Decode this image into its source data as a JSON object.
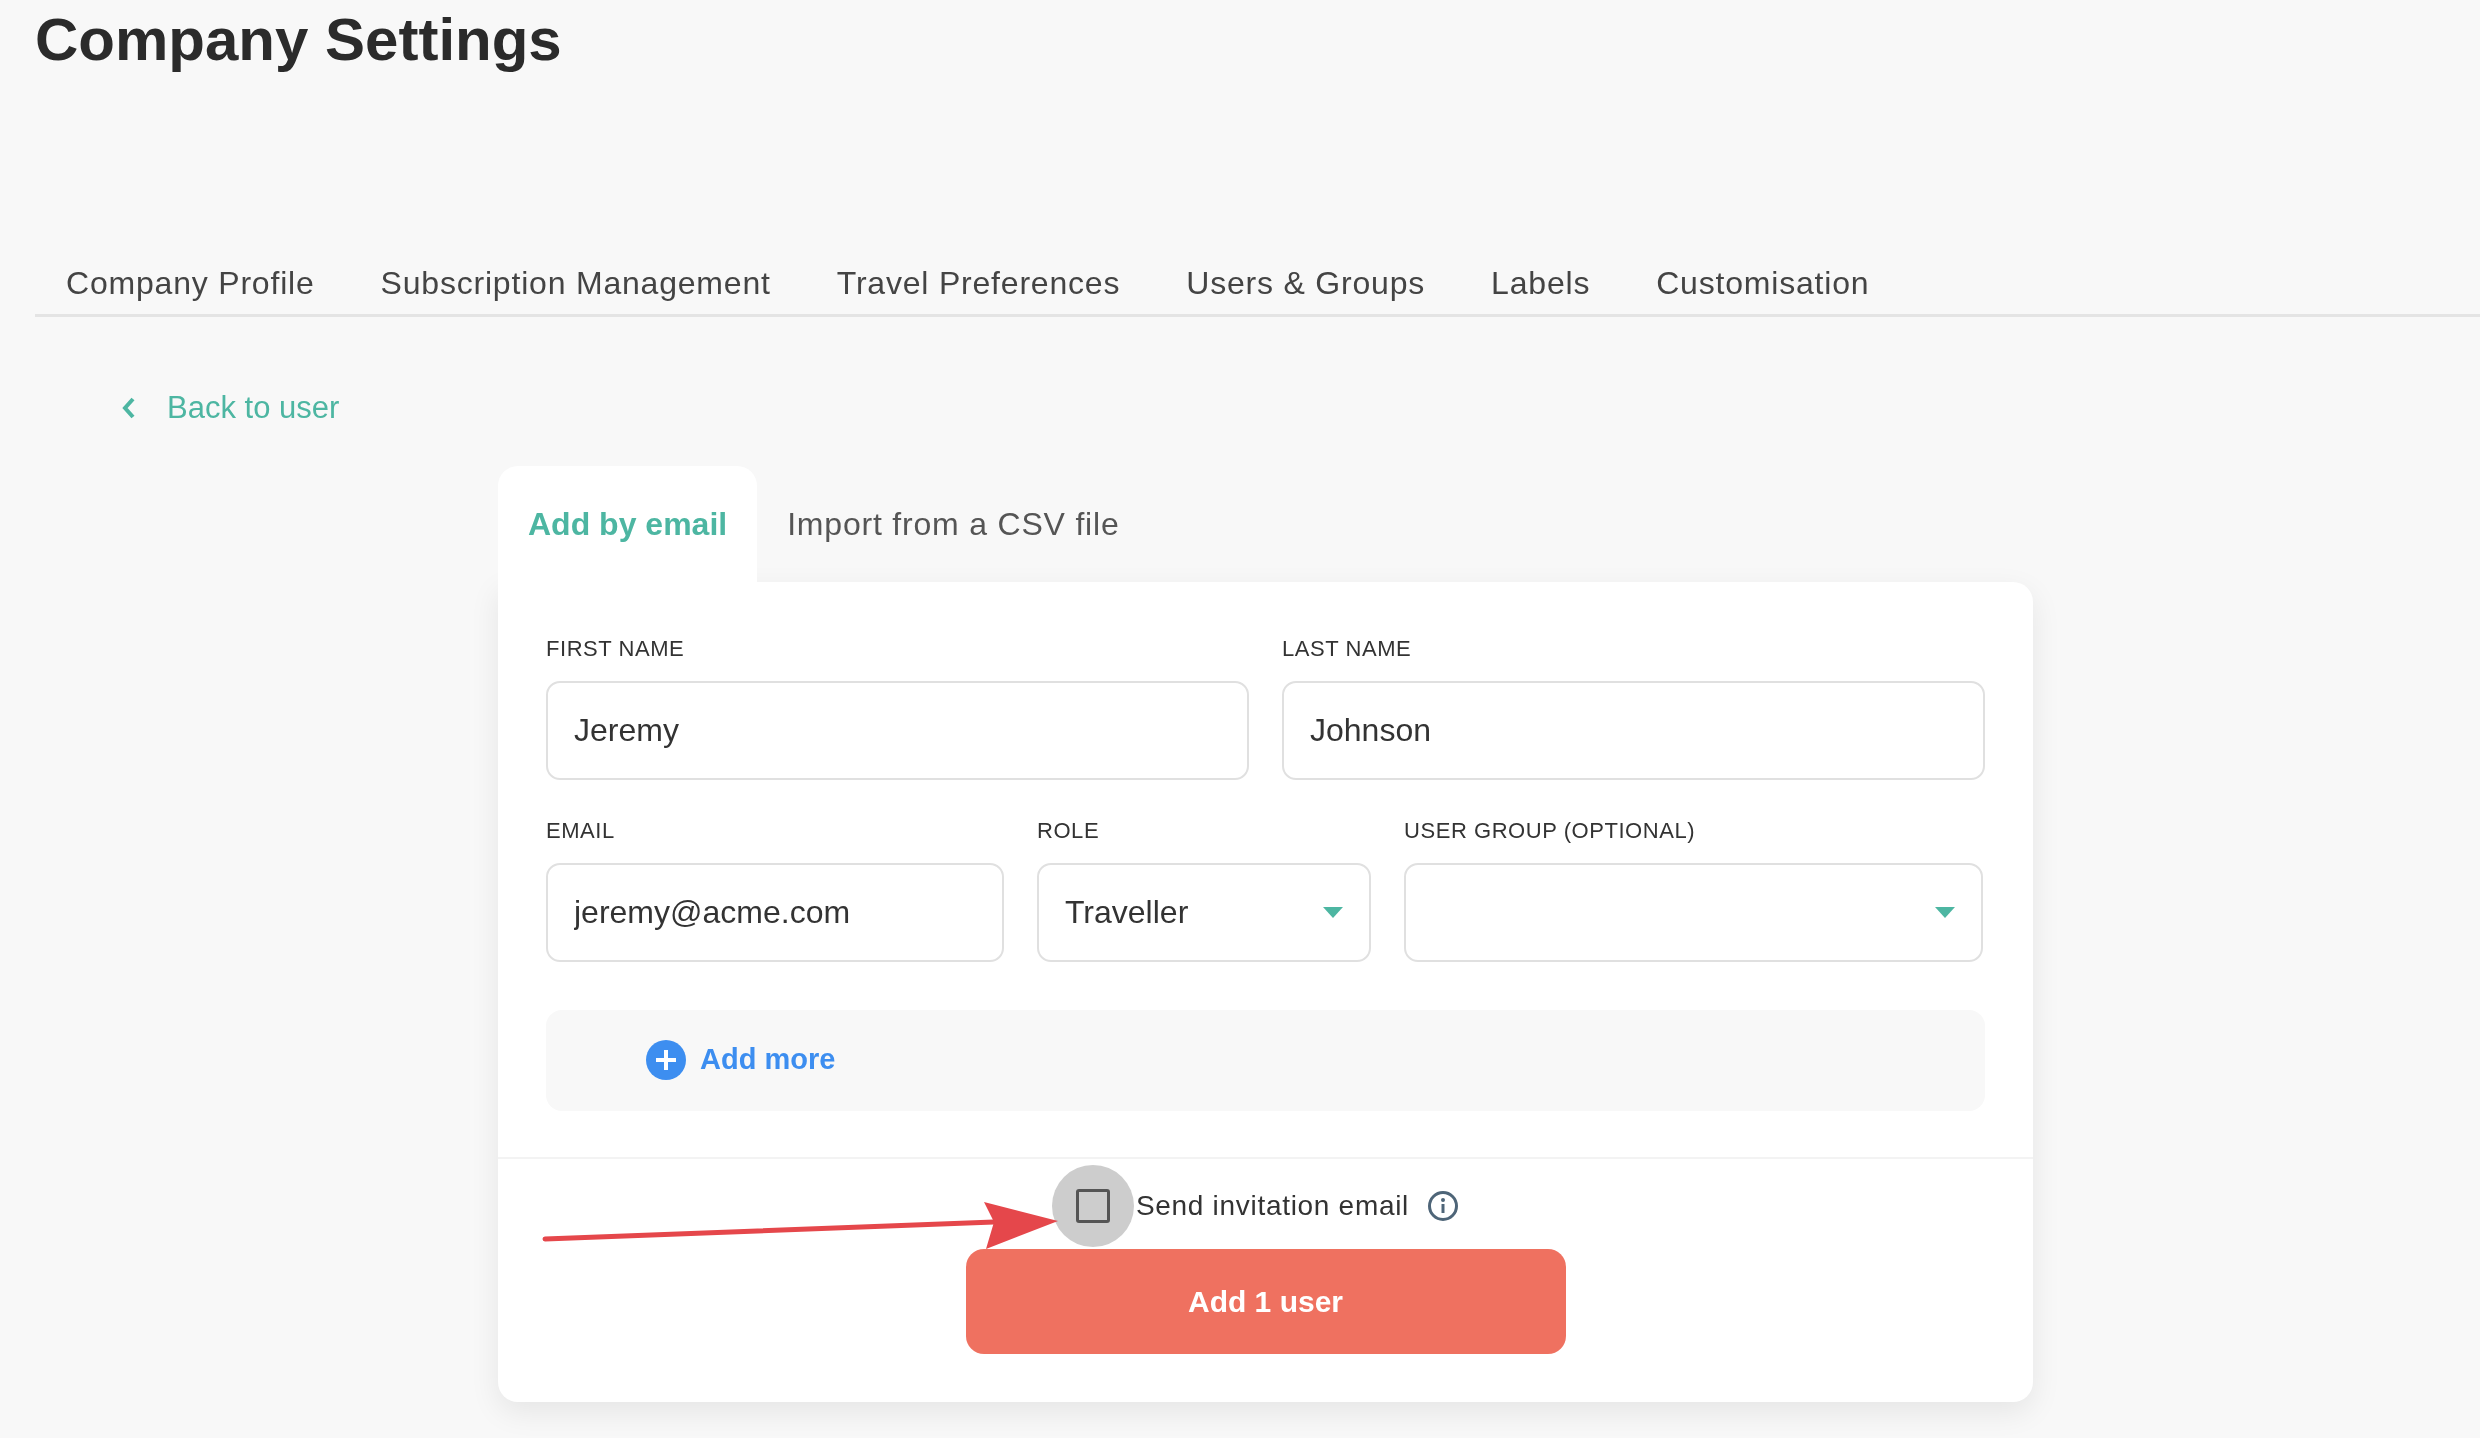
{
  "page_title": "Company Settings",
  "tabs": [
    {
      "label": "Company Profile",
      "selected": false
    },
    {
      "label": "Subscription Management",
      "selected": false
    },
    {
      "label": "Travel Preferences",
      "selected": false
    },
    {
      "label": "Users & Groups",
      "selected": false
    },
    {
      "label": "Labels",
      "selected": false
    },
    {
      "label": "Customisation",
      "selected": false
    }
  ],
  "back_link": "Back to user",
  "form_tabs": [
    {
      "label": "Add by email",
      "selected": true
    },
    {
      "label": "Import from a CSV file",
      "selected": false
    }
  ],
  "first_name": {
    "label": "FIRST NAME",
    "value": "Jeremy"
  },
  "last_name": {
    "label": "LAST NAME",
    "value": "Johnson"
  },
  "email": {
    "label": "EMAIL",
    "value": "jeremy@acme.com"
  },
  "role": {
    "label": "ROLE",
    "value": "Traveller"
  },
  "user_group": {
    "label": "USER GROUP (OPTIONAL)"
  },
  "add_more": "Add more",
  "send_invitation": {
    "label": "Send invitation email",
    "checked": false
  },
  "submit": "Add 1 user"
}
